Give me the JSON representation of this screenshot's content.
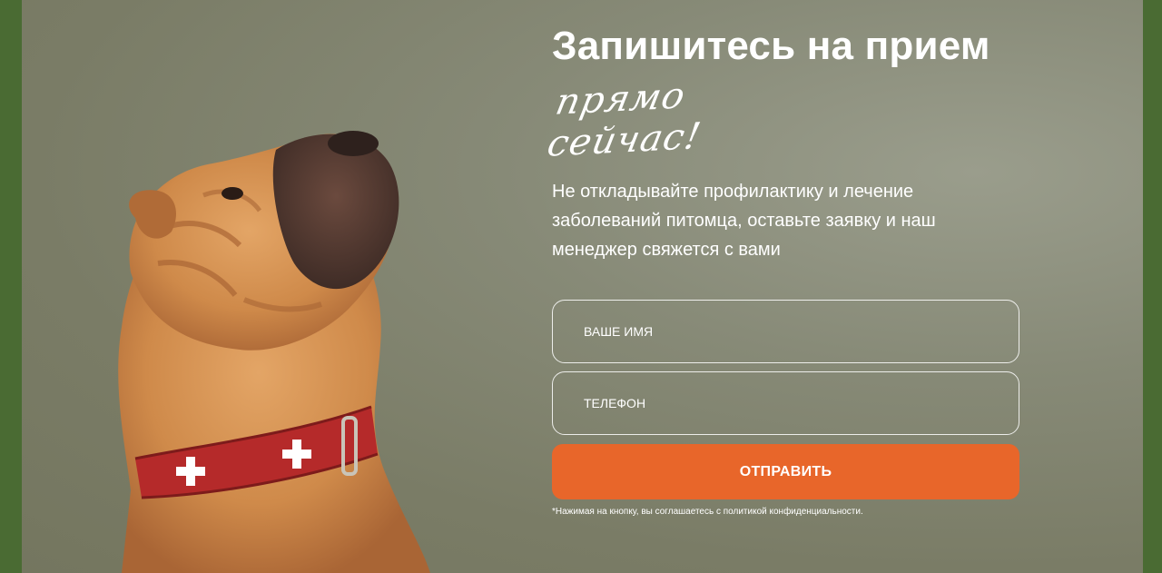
{
  "form": {
    "title": "Запишитесь на прием",
    "script_line": "прямо сейчас!",
    "description": "Не откладывайте профилактику и лечение заболеваний питомца, оставьте заявку и наш менеджер свяжется с вами",
    "name_placeholder": "ВАШЕ ИМЯ",
    "phone_placeholder": "ТЕЛЕФОН",
    "submit_label": "ОТПРАВИТЬ",
    "privacy_note": "*Нажимая на кнопку, вы соглашаетесь с политикой конфиденциальности."
  },
  "colors": {
    "background": "#4a6b33",
    "panel": "#7a7c66",
    "accent": "#e8662a",
    "collar": "#b52a2a",
    "text": "#ffffff"
  },
  "icons": {
    "image": "dog-photo"
  }
}
